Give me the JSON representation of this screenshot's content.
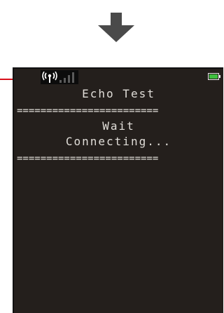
{
  "screen": {
    "title": "Echo Test",
    "separator_top": "========================",
    "status_line_1": "Wait",
    "status_line_2": "Connecting...",
    "separator_bottom": "========================"
  },
  "status_bar": {
    "antenna_icon": "antenna-icon",
    "signal_bars_icon": "signal-bars-icon",
    "battery_icon": "battery-icon",
    "battery_color": "#3fbf3f"
  },
  "annotation": {
    "arrow_icon": "down-arrow-icon",
    "callout_color": "#d8101c"
  }
}
